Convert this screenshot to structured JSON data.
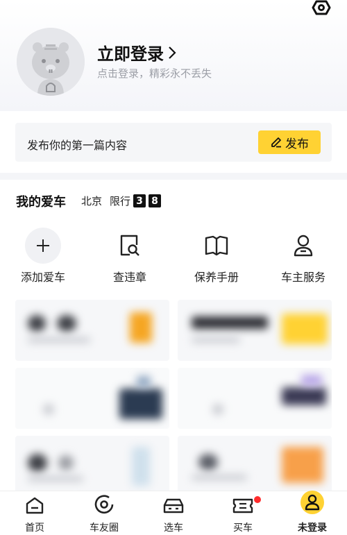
{
  "profile": {
    "login_title": "立即登录",
    "login_sub": "点击登录，精彩永不丢失"
  },
  "publish": {
    "prompt": "发布你的第一篇内容",
    "button": "发布"
  },
  "mycar": {
    "title": "我的爱车",
    "city": "北京",
    "restrict_label": "限行",
    "restrict_numbers": [
      "3",
      "8"
    ]
  },
  "actions": [
    {
      "label": "添加爱车",
      "icon": "plus-icon"
    },
    {
      "label": "查违章",
      "icon": "violation-search-icon"
    },
    {
      "label": "保养手册",
      "icon": "book-icon"
    },
    {
      "label": "车主服务",
      "icon": "person-icon"
    }
  ],
  "tabs": [
    {
      "label": "首页",
      "icon": "home-icon"
    },
    {
      "label": "车友圈",
      "icon": "circle-icon"
    },
    {
      "label": "选车",
      "icon": "car-icon"
    },
    {
      "label": "买车",
      "icon": "ticket-icon"
    },
    {
      "label": "未登录",
      "icon": "user-avatar-icon"
    }
  ],
  "colors": {
    "accent": "#ffd233",
    "badge_red": "#ff2d2d"
  }
}
